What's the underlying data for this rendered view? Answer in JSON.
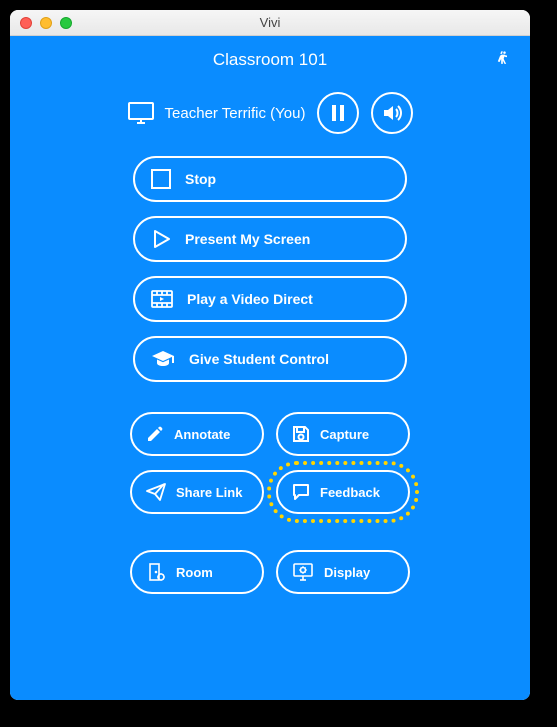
{
  "window": {
    "title": "Vivi"
  },
  "header": {
    "room_title": "Classroom 101"
  },
  "user": {
    "label": "Teacher Terrific (You)"
  },
  "actions": {
    "stop": "Stop",
    "present": "Present My Screen",
    "video": "Play a Video Direct",
    "student": "Give Student Control"
  },
  "tools": {
    "annotate": "Annotate",
    "capture": "Capture",
    "share": "Share Link",
    "feedback": "Feedback"
  },
  "settings": {
    "room": "Room",
    "display": "Display"
  }
}
